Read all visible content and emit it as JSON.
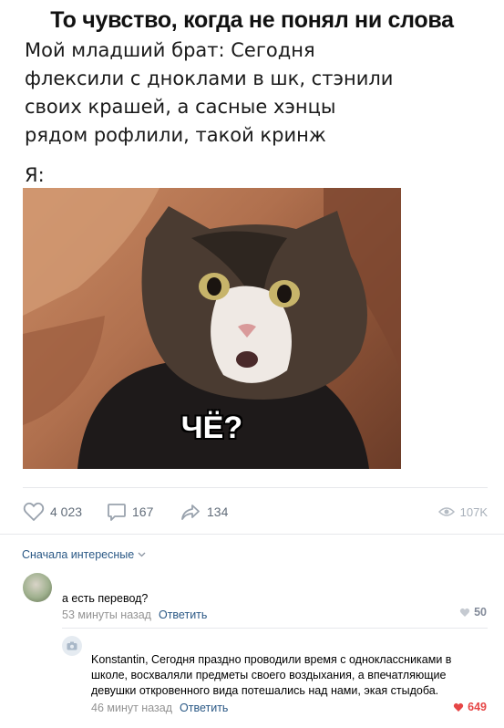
{
  "post": {
    "title": "То чувство, когда не понял ни слова",
    "text": "Мой младший брат: Сегодня флексили с дноклами в шк, стэнили своих крашей, а сасные хэнцы рядом рофлили, такой кринж",
    "me_label": "Я:",
    "meme_caption": "ЧЁ?"
  },
  "actions": {
    "likes": "4 023",
    "comments": "167",
    "shares": "134",
    "views": "107K"
  },
  "comments_sort": "Сначала интересные",
  "comments": [
    {
      "text": "а есть перевод?",
      "time": "53 минуты назад",
      "reply_label": "Ответить",
      "likes": "50"
    },
    {
      "text": "Konstantin, Сегодня праздно проводили время с одноклассниками в школе, восхваляли предметы своего воздыхания, а впечатляющие девушки откровенного вида потешались над нами, экая стыдоба.",
      "time": "46 минут назад",
      "reply_label": "Ответить",
      "likes": "649"
    }
  ],
  "colors": {
    "link": "#2a5885",
    "muted": "#939393",
    "liked": "#e64646"
  }
}
